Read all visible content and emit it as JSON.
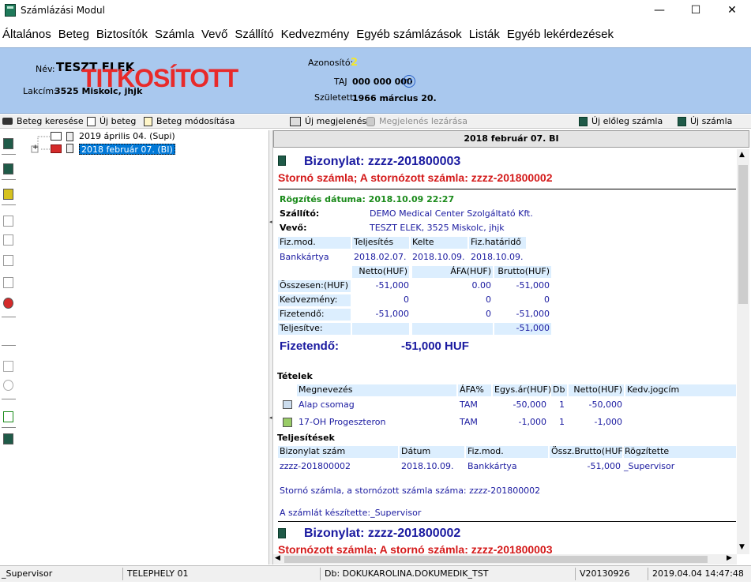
{
  "window": {
    "title": "Számlázási Modul",
    "minimize": "—",
    "maximize": "☐",
    "close": "✕"
  },
  "menu": [
    "Általános",
    "Beteg",
    "Biztosítók",
    "Számla",
    "Vevő",
    "Szállító",
    "Kedvezmény",
    "Egyéb számlázások",
    "Listák",
    "Egyéb lekérdezések"
  ],
  "patient": {
    "name_label": "Név:",
    "name": "TESZT ELEK",
    "secret_overlay": "TITKOSÍTOTT",
    "address_label": "Lakcím:",
    "address": "3525 Miskolc, jhjk",
    "id_label": "Azonosító:",
    "id": "2",
    "taj_label": "TAJ",
    "taj": "000 000 000",
    "born_label": "Született:",
    "born": "1966 március 20."
  },
  "toolbar": {
    "search": "Beteg keresése",
    "new_patient": "Új beteg",
    "modify_patient": "Beteg módosítása",
    "new_visit": "Új megjelenés",
    "close_visit": "Megjelenés lezárása",
    "new_advance": "Új előleg számla",
    "new_invoice": "Új számla"
  },
  "tree": {
    "items": [
      "2019 április 04. (Supi)",
      "2018 február 07. (BI)"
    ],
    "expander": "+"
  },
  "pane": {
    "header": "2018 február 07.   BI"
  },
  "invoice1": {
    "title": "Bizonylat: zzzz-201800003",
    "storno": "Stornó számla; A stornózott számla: zzzz-201800002",
    "recorded": "Rögzítés dátuma: 2018.10.09 22:27",
    "supplier_label": "Szállító:",
    "supplier": "DEMO Medical Center Szolgáltató Kft.",
    "buyer_label": "Vevő:",
    "buyer": "TESZT ELEK, 3525 Miskolc, jhjk",
    "pay_headers": [
      "Fiz.mod.",
      "Teljesítés",
      "Kelte",
      "Fiz.határidő"
    ],
    "pay_values": [
      "Bankkártya",
      "2018.02.07.",
      "2018.10.09.",
      "2018.10.09."
    ],
    "sum_headers": [
      "Netto(HUF)",
      "ÁFA(HUF)",
      "Brutto(HUF)"
    ],
    "sum_rows": [
      {
        "label": "Összesen:(HUF)",
        "netto": "-51,000",
        "afa": "0.00",
        "brutto": "-51,000"
      },
      {
        "label": "Kedvezmény:",
        "netto": "0",
        "afa": "0",
        "brutto": "0"
      },
      {
        "label": "Fizetendő:",
        "netto": "-51,000",
        "afa": "0",
        "brutto": "-51,000"
      },
      {
        "label": "Teljesítve:",
        "netto": "",
        "afa": "",
        "brutto": "-51,000"
      }
    ],
    "payable_label": "Fizetendő:",
    "payable_value": "-51,000 HUF",
    "items_title": "Tételek",
    "item_headers": [
      "Megnevezés",
      "ÁFA%",
      "Egys.ár(HUF)",
      "Db",
      "Netto(HUF)",
      "Kedv.jogcím"
    ],
    "items": [
      {
        "name": "Alap csomag",
        "afa": "TAM",
        "price": "-50,000",
        "qty": "1",
        "netto": "-50,000",
        "icon": "package-icon"
      },
      {
        "name": "17-OH Progeszteron",
        "afa": "TAM",
        "price": "-1,000",
        "qty": "1",
        "netto": "-1,000",
        "icon": "lab-icon"
      }
    ],
    "payments_title": "Teljesítések",
    "payment_headers": [
      "Bizonylat szám",
      "Dátum",
      "Fiz.mod.",
      "Össz.Brutto(HUF)",
      "Rögzítette"
    ],
    "payment_row": {
      "doc": "zzzz-201800002",
      "date": "2018.10.09.",
      "mode": "Bankkártya",
      "brutto": "-51,000",
      "by": "_Supervisor"
    },
    "note": "Stornó számla, a stornózott számla száma: zzzz-201800002",
    "made_by": "A számlát készítette:_Supervisor"
  },
  "invoice2": {
    "title": "Bizonylat: zzzz-201800002",
    "storno": "Stornózott számla; A stornó számla: zzzz-201800003"
  },
  "status": {
    "user": "_Supervisor",
    "site": "TELEPHELY 01",
    "db": "Db: DOKUKAROLINA.DOKUMEDIK_TST",
    "version": "V20130926",
    "datetime": "2019.04.04 14:47:48"
  },
  "colors": {
    "header_bg": "#a9c8ee",
    "selection": "#0078d7",
    "invoice_title": "#1a1aa0",
    "storno_red": "#d41a1a",
    "recorded_green": "#1a8a1a"
  }
}
